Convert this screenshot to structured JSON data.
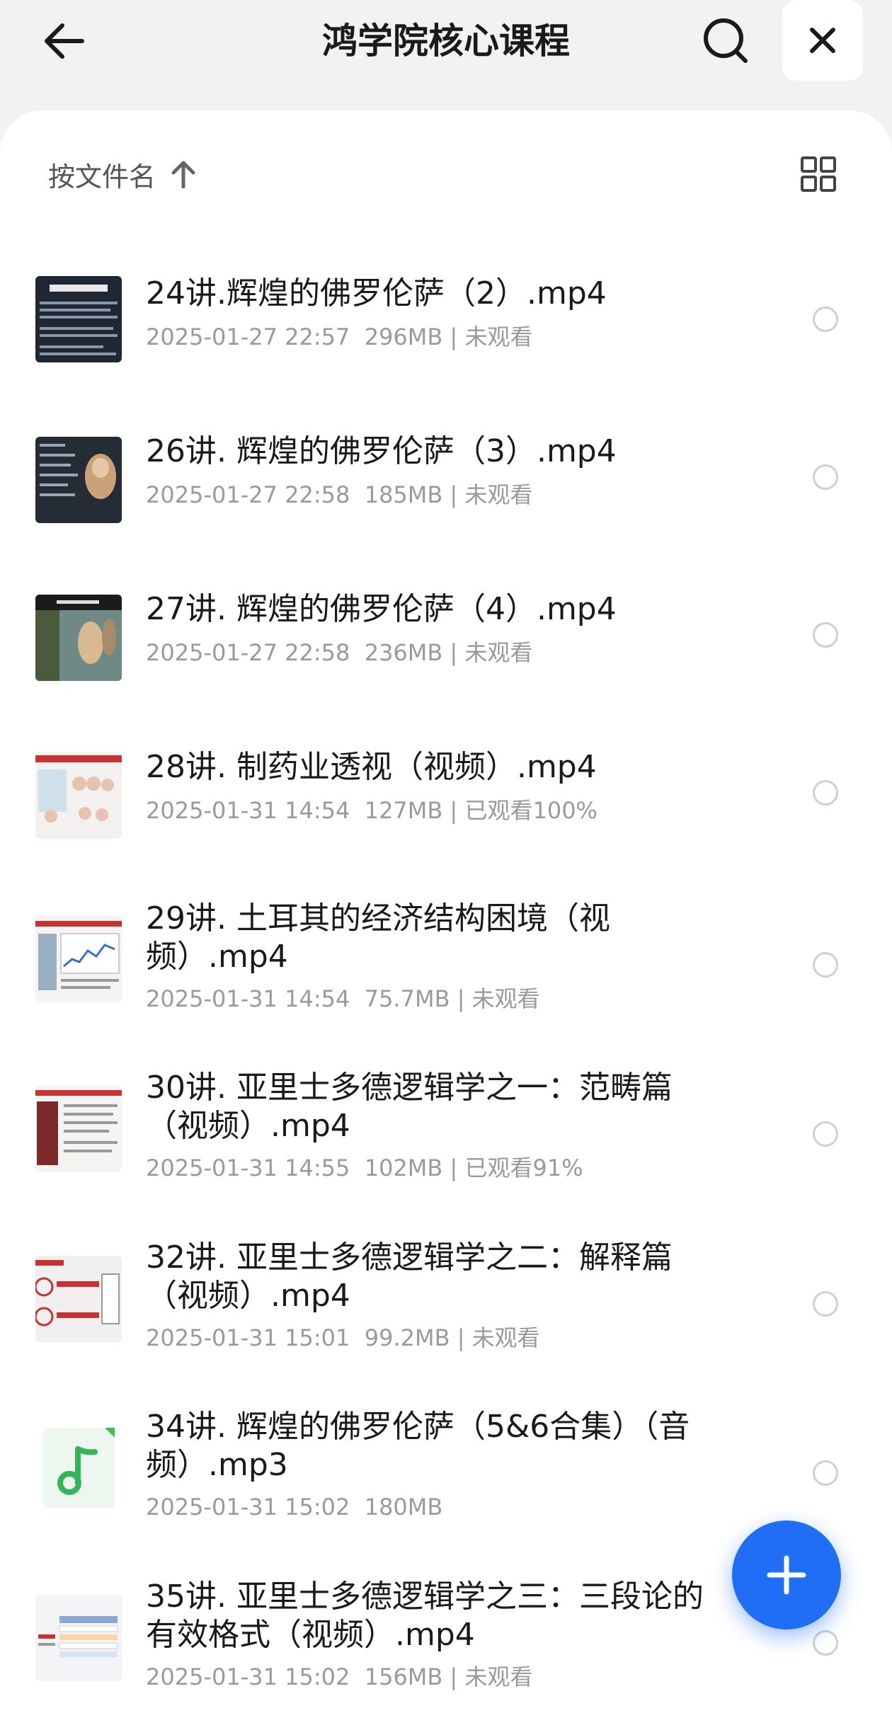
{
  "header": {
    "title": "鸿学院核心课程",
    "back_icon": "arrow-left-icon",
    "search_icon": "search-icon",
    "close_icon": "close-icon"
  },
  "toolbar": {
    "sort_label": "按文件名",
    "sort_icon": "arrow-up-icon",
    "view_icon": "grid-view-icon"
  },
  "files": [
    {
      "name": "24讲.辉煌的佛罗伦萨（2）.mp4",
      "meta": "2025-01-27 22:57  296MB | 未观看",
      "thumb": "video-thumbnail"
    },
    {
      "name": "26讲. 辉煌的佛罗伦萨（3）.mp4",
      "meta": "2025-01-27 22:58  185MB | 未观看",
      "thumb": "video-thumbnail"
    },
    {
      "name": "27讲. 辉煌的佛罗伦萨（4）.mp4",
      "meta": "2025-01-27 22:58  236MB | 未观看",
      "thumb": "video-thumbnail"
    },
    {
      "name": "28讲. 制药业透视（视频）.mp4",
      "meta": "2025-01-31 14:54  127MB | 已观看100%",
      "thumb": "video-thumbnail"
    },
    {
      "name": "29讲. 土耳其的经济结构困境（视频）.mp4",
      "meta": "2025-01-31 14:54  75.7MB | 未观看",
      "thumb": "video-thumbnail"
    },
    {
      "name": "30讲. 亚里士多德逻辑学之一：范畴篇（视频）.mp4",
      "meta": "2025-01-31 14:55  102MB | 已观看91%",
      "thumb": "video-thumbnail"
    },
    {
      "name": "32讲. 亚里士多德逻辑学之二：解释篇（视频）.mp4",
      "meta": "2025-01-31 15:01  99.2MB | 未观看",
      "thumb": "video-thumbnail"
    },
    {
      "name": "34讲. 辉煌的佛罗伦萨（5&6合集）（音频）.mp3",
      "meta": "2025-01-31 15:02  180MB",
      "thumb": "music-note-icon"
    },
    {
      "name": "35讲. 亚里士多德逻辑学之三：三段论的有效格式（视频）.mp4",
      "meta": "2025-01-31 15:02  156MB | 未观看",
      "thumb": "video-thumbnail"
    }
  ],
  "fab": {
    "icon": "plus-icon",
    "color": "#1f6ef5"
  }
}
